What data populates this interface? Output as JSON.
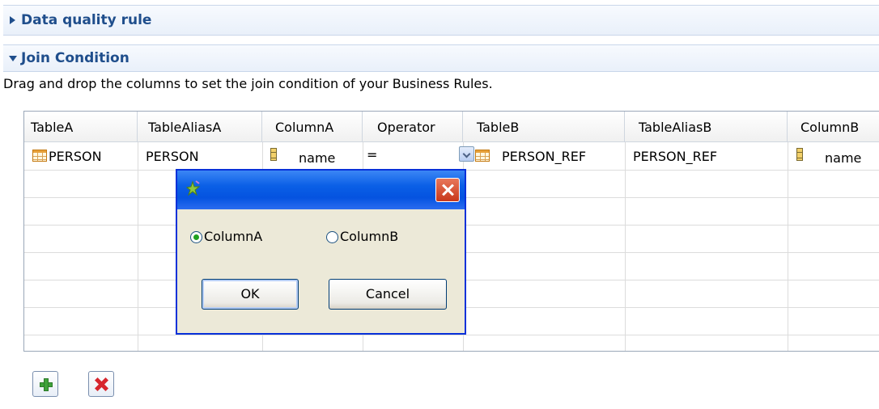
{
  "sections": {
    "data_quality_rule": "Data quality rule",
    "join_condition": "Join Condition"
  },
  "description": "Drag and drop the columns to set the join condition of your Business Rules.",
  "table": {
    "headers": [
      "TableA",
      "TableAliasA",
      "ColumnA",
      "Operator",
      "TableB",
      "TableAliasB",
      "ColumnB"
    ],
    "row": {
      "tableA": "PERSON",
      "aliasA": "PERSON",
      "columnA": "name",
      "operator": "=",
      "tableB": "PERSON_REF",
      "aliasB": "PERSON_REF",
      "columnB": "name"
    }
  },
  "dialog": {
    "options": [
      "ColumnA",
      "ColumnB"
    ],
    "selected": "ColumnA",
    "ok_label": "OK",
    "cancel_label": "Cancel"
  },
  "toolbar": {
    "add_icon": "plus-icon",
    "delete_icon": "delete-icon"
  },
  "colors": {
    "section_title": "#1f4e8c",
    "dialog_titlebar": "#0a5fe6",
    "close_button": "#c8381b"
  }
}
